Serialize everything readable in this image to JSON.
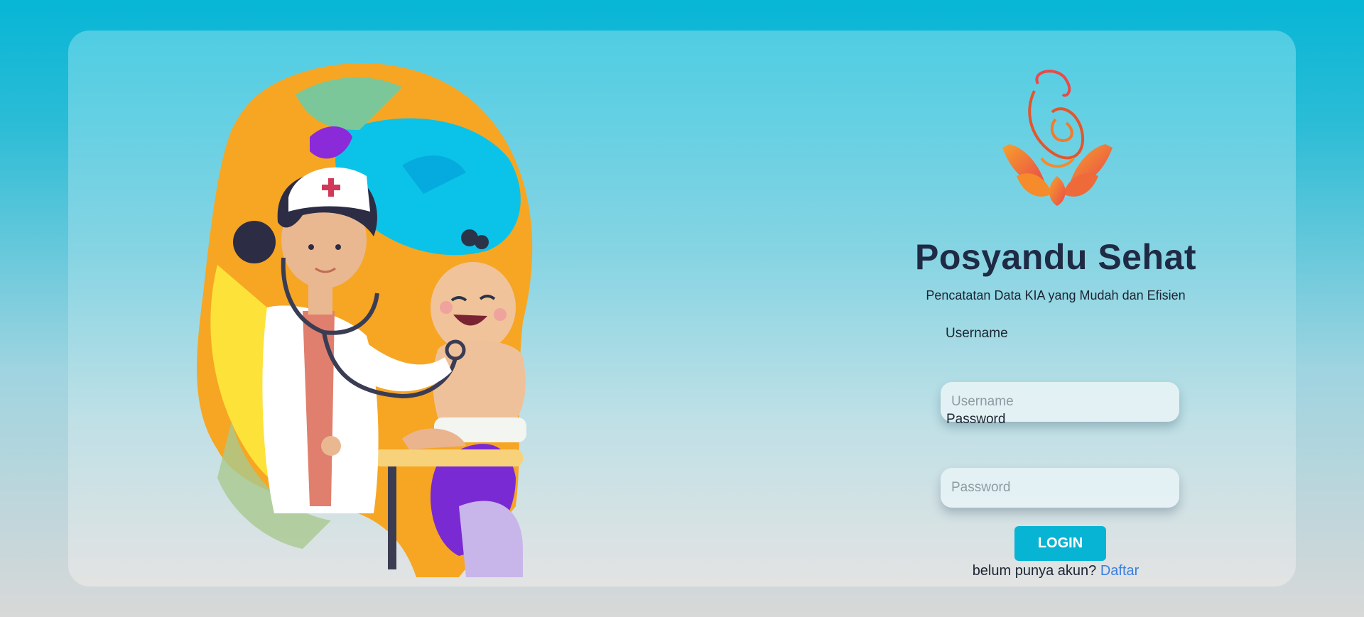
{
  "app": {
    "title": "Posyandu Sehat",
    "subtitle": "Pencatatan Data KIA yang Mudah dan Efisien"
  },
  "form": {
    "username_label": "Username",
    "username_placeholder": "Username",
    "username_value": "",
    "password_label": "Password",
    "password_placeholder": "Password",
    "password_value": "",
    "login_label": "LOGIN",
    "register_prompt": "belum punya akun?",
    "register_link": "Daftar"
  },
  "icons": {
    "logo": "mother-and-child-lotus-logo",
    "illustration": "doctor-examining-baby-illustration"
  },
  "colors": {
    "background_top": "#07b6d6",
    "title": "#1f2a44",
    "button": "#08b4d4",
    "link": "#3a7fe0"
  }
}
